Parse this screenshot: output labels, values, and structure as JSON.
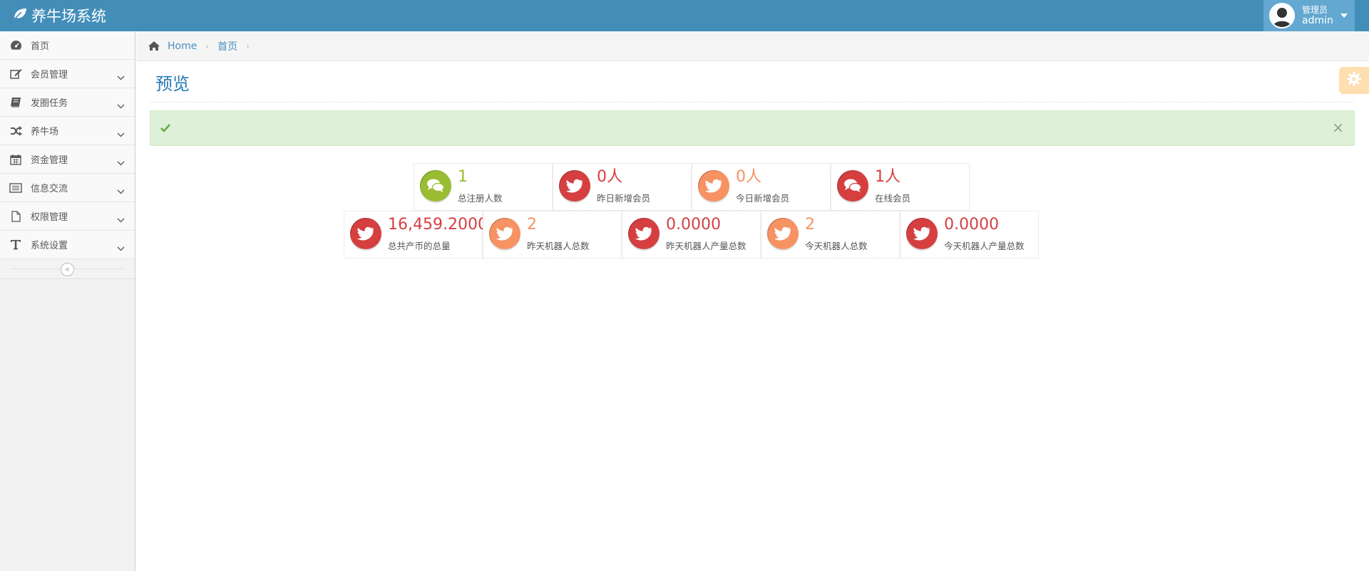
{
  "navbar": {
    "brand": "养牛场系统",
    "user_role": "管理员",
    "user_name": "admin"
  },
  "sidebar": {
    "items": [
      {
        "label": "首页",
        "icon": "dashboard-icon",
        "expandable": false
      },
      {
        "label": "会员管理",
        "icon": "edit-icon",
        "expandable": true
      },
      {
        "label": "发圈任务",
        "icon": "book-icon",
        "expandable": true
      },
      {
        "label": "养牛场",
        "icon": "random-icon",
        "expandable": true
      },
      {
        "label": "资金管理",
        "icon": "calendar-icon",
        "expandable": true
      },
      {
        "label": "信息交流",
        "icon": "list-icon",
        "expandable": true
      },
      {
        "label": "权限管理",
        "icon": "file-icon",
        "expandable": true
      },
      {
        "label": "系统设置",
        "icon": "text-icon",
        "expandable": true
      }
    ],
    "collapse_symbol": "«"
  },
  "breadcrumbs": {
    "home": "Home",
    "current": "首页"
  },
  "page": {
    "title": "预览"
  },
  "alert": {
    "type": "success",
    "close_symbol": "×"
  },
  "stats": {
    "row1": [
      {
        "value": "1",
        "label": "总注册人数",
        "icon": "comments-icon",
        "color": "#9abc32"
      },
      {
        "value": "0人",
        "label": "昨日新增会员",
        "icon": "twitter-icon",
        "color": "#d53f40"
      },
      {
        "value": "0人",
        "label": "今日新增会员",
        "icon": "twitter-icon",
        "color": "#f79263"
      },
      {
        "value": "1人",
        "label": "在线会员",
        "icon": "comments-icon",
        "color": "#d53f40"
      }
    ],
    "row2": [
      {
        "value": "16,459.2000",
        "label": "总共产币的总量",
        "icon": "twitter-icon",
        "color": "#d53f40"
      },
      {
        "value": "2",
        "label": "昨天机器人总数",
        "icon": "twitter-icon",
        "color": "#f79263"
      },
      {
        "value": "0.0000",
        "label": "昨天机器人产量总数",
        "icon": "twitter-icon",
        "color": "#d53f40"
      },
      {
        "value": "2",
        "label": "今天机器人总数",
        "icon": "twitter-icon",
        "color": "#f79263"
      },
      {
        "value": "0.0000",
        "label": "今天机器人产量总数",
        "icon": "twitter-icon",
        "color": "#d53f40"
      }
    ]
  },
  "colors": {
    "navbar": "#438eb9",
    "user_area": "#62a8d1",
    "title": "#2679b5",
    "link": "#4c8fbd",
    "alert_bg": "#dff0d8"
  }
}
